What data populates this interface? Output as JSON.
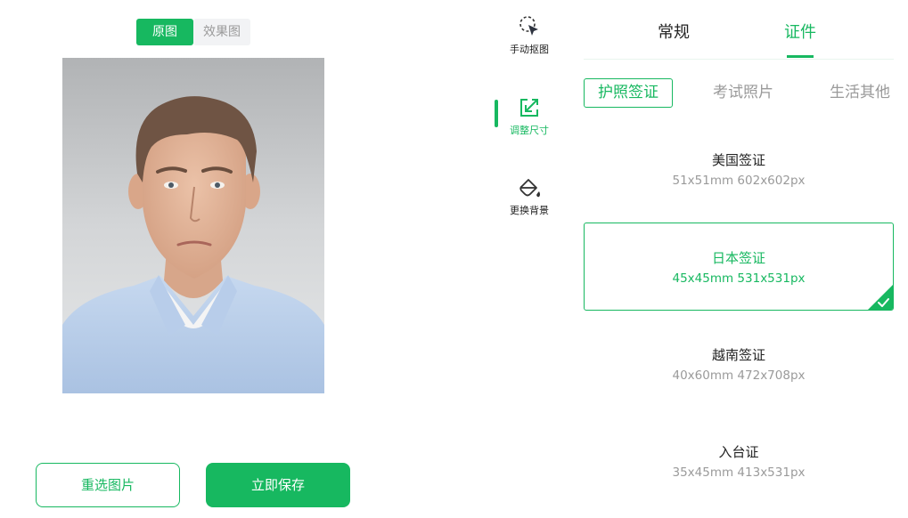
{
  "preview": {
    "toggle": {
      "original_label": "原图",
      "effect_label": "效果图",
      "active": "original"
    }
  },
  "actions": {
    "reselect_label": "重选图片",
    "save_label": "立即保存"
  },
  "tools": [
    {
      "label": "手动抠图",
      "icon": "lasso-cursor-icon",
      "active": false
    },
    {
      "label": "调整尺寸",
      "icon": "resize-icon",
      "active": true
    },
    {
      "label": "更换背景",
      "icon": "paint-bucket-icon",
      "active": false
    }
  ],
  "tabs": {
    "normal_label": "常规",
    "cert_label": "证件",
    "active": "cert"
  },
  "subtabs": [
    {
      "label": "护照签证",
      "active": true
    },
    {
      "label": "考试照片",
      "active": false
    },
    {
      "label": "生活其他",
      "active": false
    }
  ],
  "sizes": [
    {
      "name": "美国签证",
      "spec": "51x51mm 602x602px",
      "selected": false
    },
    {
      "name": "日本签证",
      "spec": "45x45mm 531x531px",
      "selected": true
    },
    {
      "name": "越南签证",
      "spec": "40x60mm 472x708px",
      "selected": false
    },
    {
      "name": "入台证",
      "spec": "35x45mm 413x531px",
      "selected": false
    }
  ],
  "colors": {
    "accent": "#17b860",
    "muted_text": "#9a9a9a",
    "inactive_bg": "#f2f3f5"
  }
}
